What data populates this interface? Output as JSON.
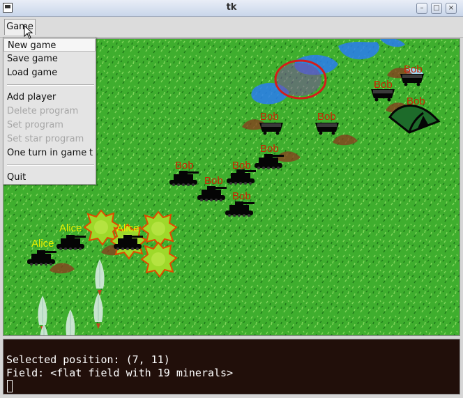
{
  "window": {
    "title": "tk"
  },
  "menubar": {
    "game_label": "Game"
  },
  "menu": {
    "items": [
      {
        "label": "New game",
        "enabled": true,
        "highlighted": true,
        "accel": ""
      },
      {
        "label": "Save game",
        "enabled": true,
        "highlighted": false,
        "accel": ""
      },
      {
        "label": "Load game",
        "enabled": true,
        "highlighted": false,
        "accel": ""
      },
      {
        "label": "Add player",
        "enabled": true,
        "highlighted": false,
        "accel": ""
      },
      {
        "label": "Delete program",
        "enabled": false,
        "highlighted": false,
        "accel": ""
      },
      {
        "label": "Set program",
        "enabled": false,
        "highlighted": false,
        "accel": ""
      },
      {
        "label": "Set star program",
        "enabled": false,
        "highlighted": false,
        "accel": ""
      },
      {
        "label": "One turn in game",
        "enabled": true,
        "highlighted": false,
        "accel": "t"
      },
      {
        "label": "Quit",
        "enabled": true,
        "highlighted": false,
        "accel": ""
      }
    ]
  },
  "map": {
    "players": [
      {
        "name": "Bob",
        "color": "#cc2200"
      },
      {
        "name": "Alice",
        "color": "#e8f000"
      }
    ],
    "labels": {
      "bob": "Bob",
      "alice": "Alice"
    },
    "colors": {
      "grass": "#3fae2e",
      "water": "#2a7cf0",
      "selection_ring": "#d41c1c",
      "explosion": "#9ed92a"
    }
  },
  "console": {
    "line1": "Selected position: (7, 11)",
    "line2": "Field: <flat field with 19 minerals>"
  }
}
